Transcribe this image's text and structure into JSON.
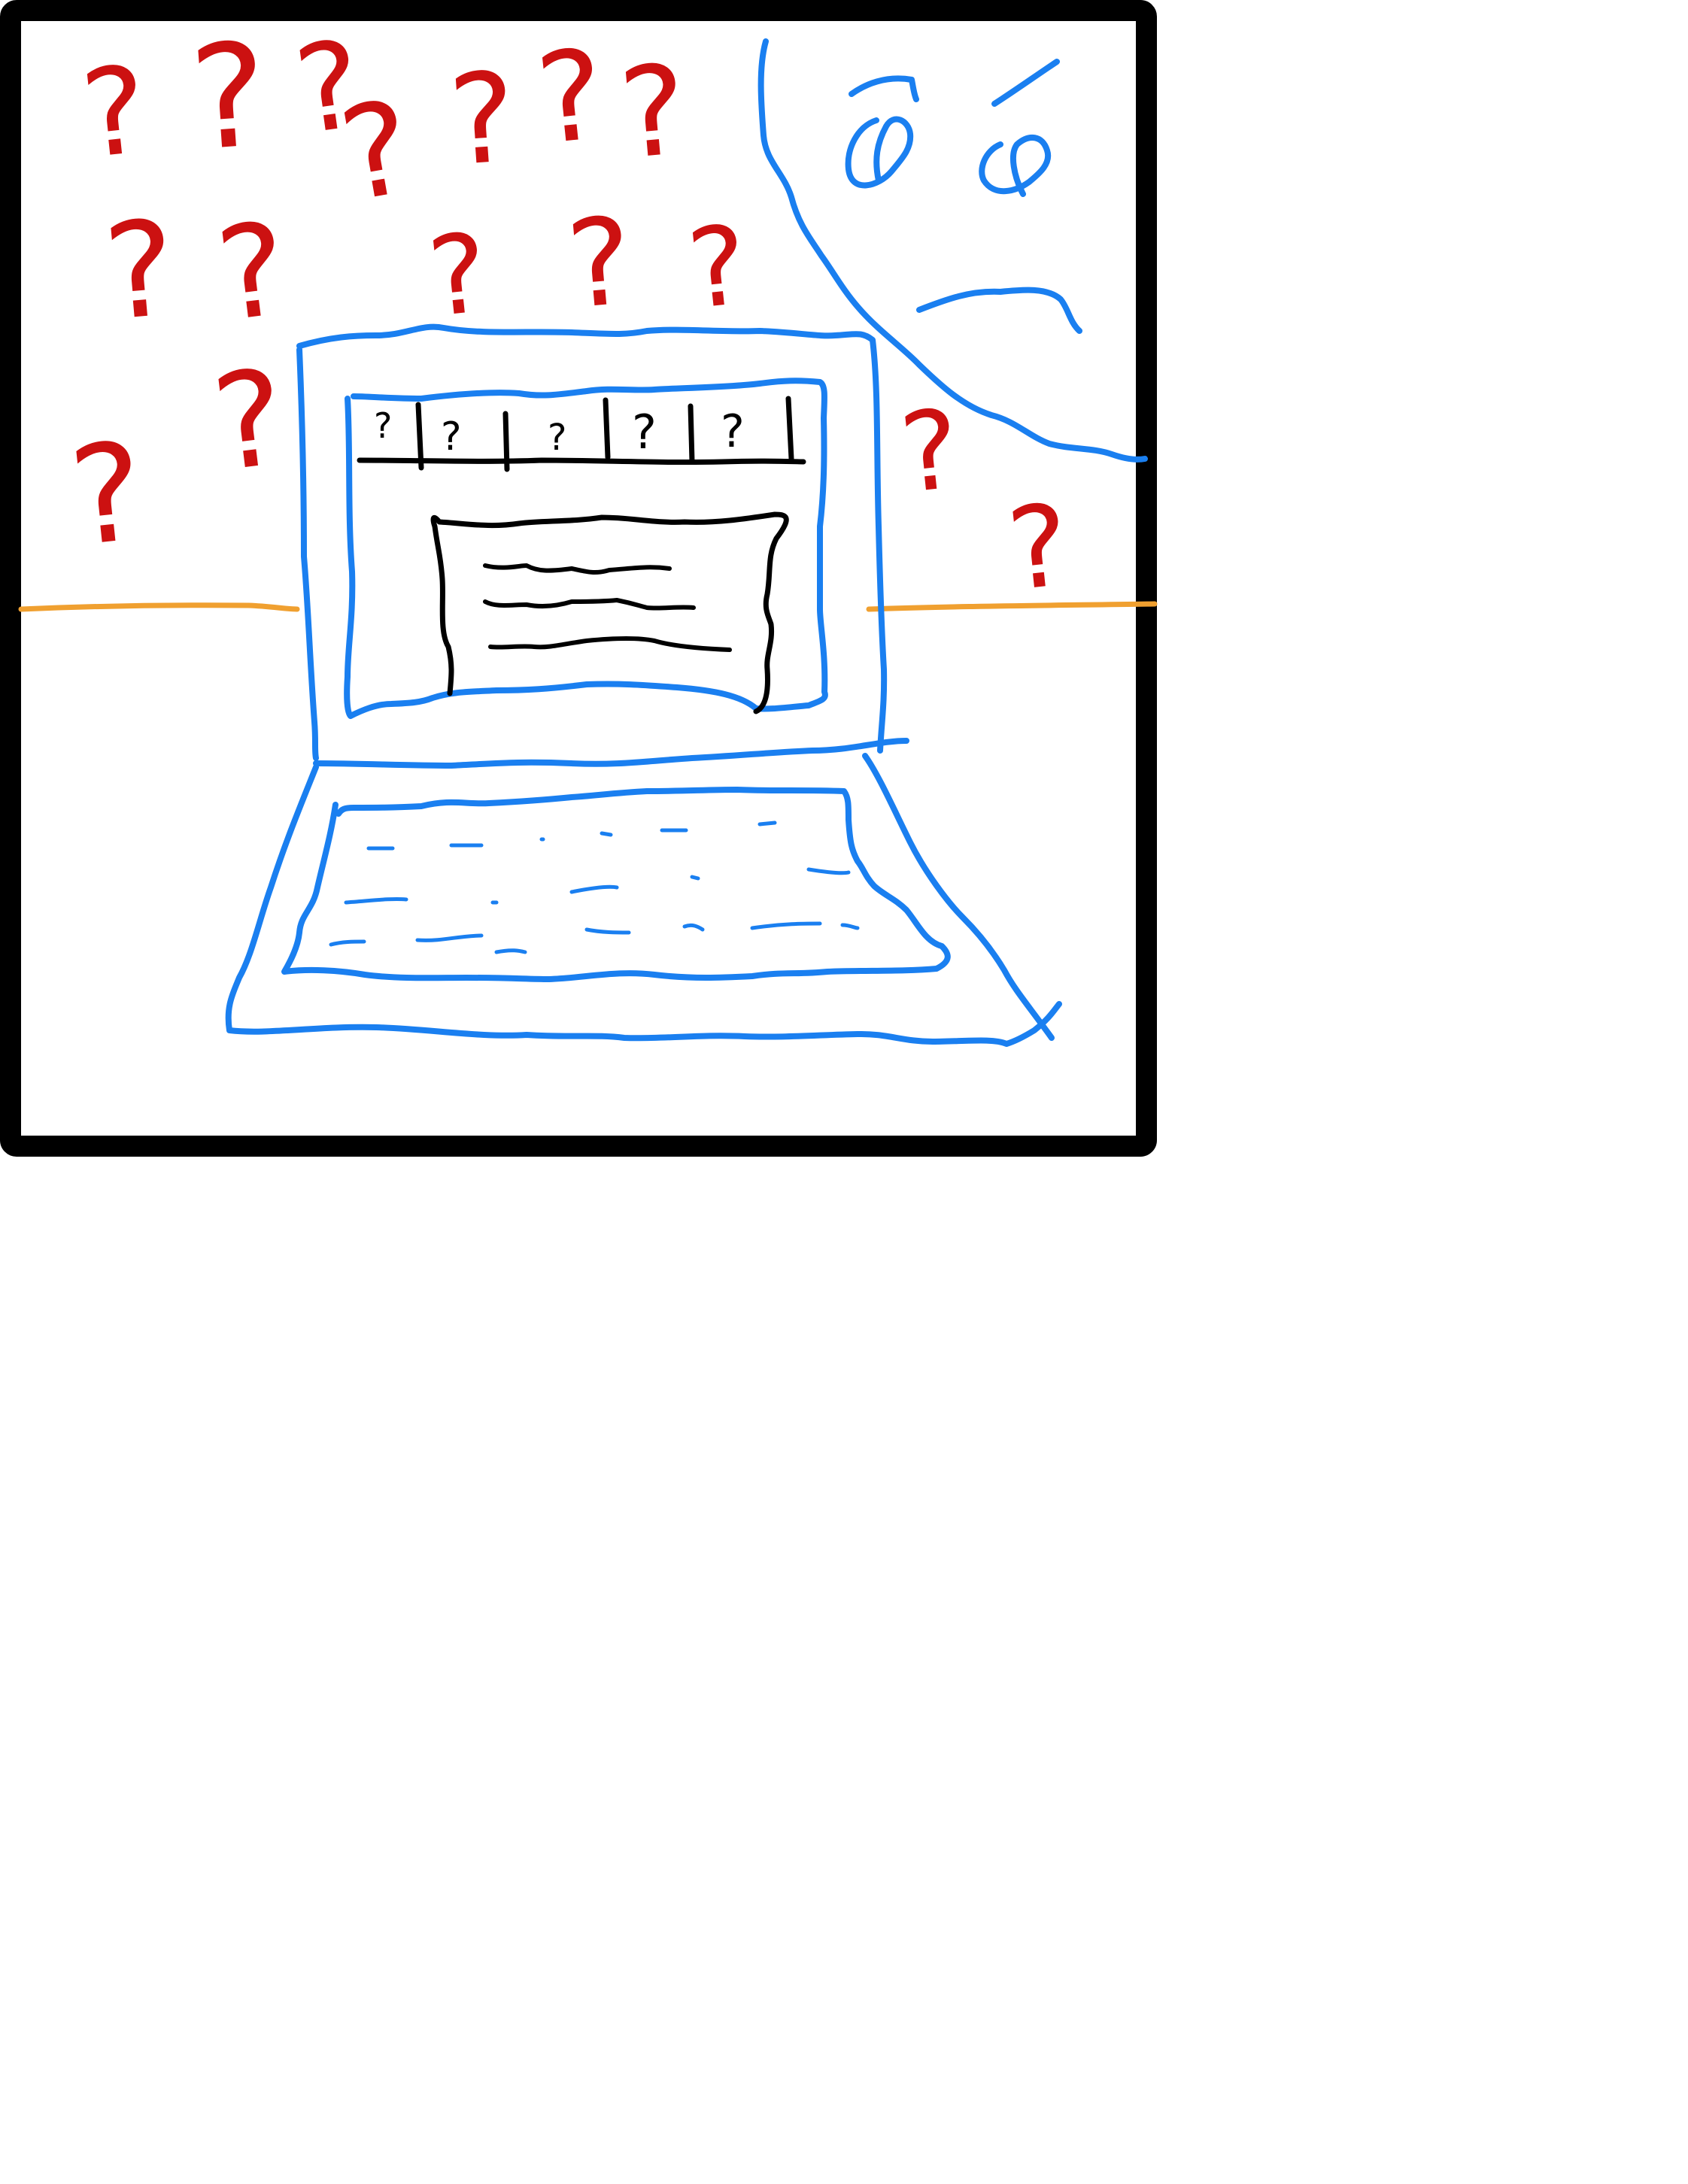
{
  "colors": {
    "frame": "#000000",
    "question_marks": "#cc1111",
    "laptop": "#1a7ff0",
    "screen_ui": "#000000",
    "table_line": "#f0a030",
    "background": "#ffffff"
  },
  "glyphs": {
    "question_mark": "?"
  },
  "laptop": {
    "menu_bar": {
      "items": [
        "?",
        "?",
        "?",
        "?",
        "?"
      ]
    },
    "dialog": {
      "text_lines": 3
    },
    "keyboard": {
      "key_rows": 3
    }
  },
  "person": {
    "icon": "confused-face-icon"
  }
}
